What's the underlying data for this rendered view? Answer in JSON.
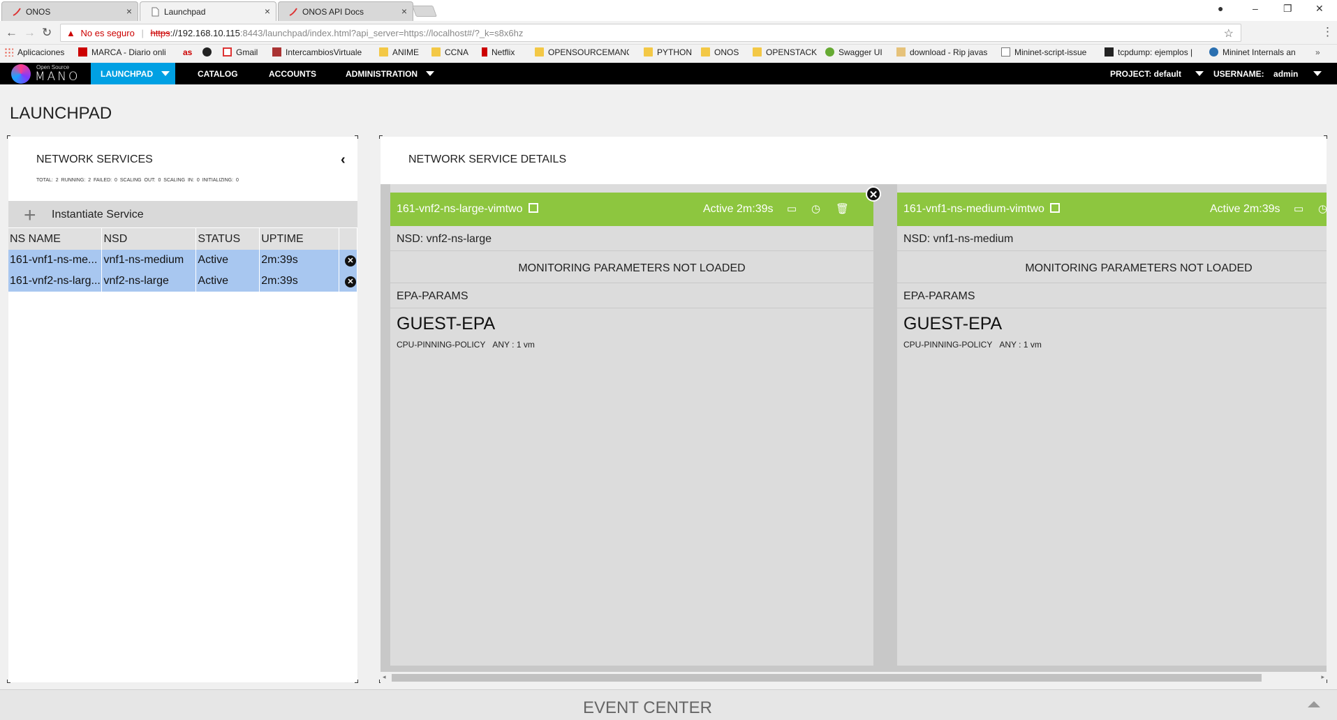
{
  "browser": {
    "tabs": [
      {
        "title": "ONOS",
        "active": false
      },
      {
        "title": "Launchpad",
        "active": true
      },
      {
        "title": "ONOS API Docs",
        "active": false
      }
    ],
    "security_label": "No es seguro",
    "url_protocol": "https",
    "url_host": "://192.168.10.115",
    "url_path": ":8443/launchpad/index.html?api_server=https://localhost#/?_k=s8x6hz",
    "bookmarks": [
      "Aplicaciones",
      "MARCA - Diario onli",
      "as",
      "",
      "Gmail",
      "IntercambiosVirtuale",
      "ANIME",
      "CCNA",
      "Netflix",
      "OPENSOURCEMANO",
      "PYTHON",
      "ONOS",
      "OPENSTACK",
      "Swagger UI",
      "download - Rip javas",
      "Mininet-script-issue",
      "tcpdump: ejemplos |",
      "Mininet Internals an"
    ]
  },
  "app": {
    "logo_small": "Open Source",
    "logo_text": "MANO",
    "nav": {
      "launchpad": "LAUNCHPAD",
      "catalog": "CATALOG",
      "accounts": "ACCOUNTS",
      "administration": "ADMINISTRATION"
    },
    "project_label": "PROJECT: default",
    "username_label": "USERNAME:",
    "username": "admin",
    "accent": "#00a0e3"
  },
  "page_title": "LAUNCHPAD",
  "network_services": {
    "heading": "NETWORK SERVICES",
    "stats": "TOTAL: 2 RUNNING: 2 FAILED: 0 SCALING OUT: 0 SCALING IN: 0 INITIALIZING: 0",
    "instantiate_label": "Instantiate Service",
    "columns": [
      "NS NAME",
      "NSD",
      "STATUS",
      "UPTIME"
    ],
    "rows": [
      {
        "name": "161-vnf1-ns-me...",
        "nsd": "vnf1-ns-medium",
        "status": "Active",
        "uptime": "2m:39s"
      },
      {
        "name": "161-vnf2-ns-larg...",
        "nsd": "vnf2-ns-large",
        "status": "Active",
        "uptime": "2m:39s"
      }
    ],
    "row_highlight": "#a8c7f0"
  },
  "details": {
    "heading": "NETWORK SERVICE DETAILS",
    "status_color": "#8dc63f",
    "cards": [
      {
        "title": "161-vnf2-ns-large-vimtwo",
        "status": "Active 2m:39s",
        "nsd": "NSD: vnf2-ns-large",
        "monitoring": "MONITORING PARAMETERS NOT LOADED",
        "epa_label": "EPA-PARAMS",
        "guest_epa": "GUEST-EPA",
        "cpu_policy_label": "CPU-PINNING-POLICY",
        "cpu_policy_value": "ANY : 1 vm"
      },
      {
        "title": "161-vnf1-ns-medium-vimtwo",
        "status": "Active 2m:39s",
        "nsd": "NSD: vnf1-ns-medium",
        "monitoring": "MONITORING PARAMETERS NOT LOADED",
        "epa_label": "EPA-PARAMS",
        "guest_epa": "GUEST-EPA",
        "cpu_policy_label": "CPU-PINNING-POLICY",
        "cpu_policy_value": "ANY : 1 vm"
      }
    ]
  },
  "event_center": {
    "title": "EVENT CENTER"
  }
}
